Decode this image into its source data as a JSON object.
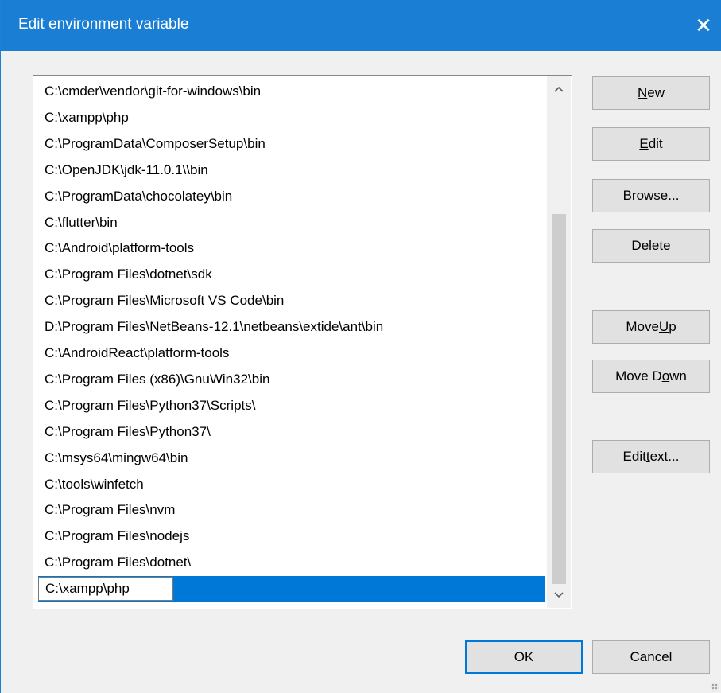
{
  "window": {
    "title": "Edit environment variable",
    "close_glyph": "✕"
  },
  "list": {
    "items": [
      "C:\\cmder\\vendor\\git-for-windows\\bin",
      "C:\\xampp\\php",
      "C:\\ProgramData\\ComposerSetup\\bin",
      "C:\\OpenJDK\\jdk-11.0.1\\\\bin",
      "C:\\ProgramData\\chocolatey\\bin",
      "C:\\flutter\\bin",
      "C:\\Android\\platform-tools",
      "C:\\Program Files\\dotnet\\sdk",
      "C:\\Program Files\\Microsoft VS Code\\bin",
      "D:\\Program Files\\NetBeans-12.1\\netbeans\\extide\\ant\\bin",
      "C:\\AndroidReact\\platform-tools",
      "C:\\Program Files (x86)\\GnuWin32\\bin",
      "C:\\Program Files\\Python37\\Scripts\\",
      "C:\\Program Files\\Python37\\",
      "C:\\msys64\\mingw64\\bin",
      "C:\\tools\\winfetch",
      "C:\\Program Files\\nvm",
      "C:\\Program Files\\nodejs",
      "C:\\Program Files\\dotnet\\"
    ],
    "editing_value": "C:\\xampp\\php",
    "scroll_up_icon": "up-arrow",
    "scroll_down_icon": "down-arrow"
  },
  "buttons": {
    "new": {
      "pre": "",
      "accel": "N",
      "post": "ew"
    },
    "edit": {
      "pre": "",
      "accel": "E",
      "post": "dit"
    },
    "browse": {
      "pre": "",
      "accel": "B",
      "post": "rowse..."
    },
    "delete": {
      "pre": "",
      "accel": "D",
      "post": "elete"
    },
    "move_up": {
      "pre": "Move ",
      "accel": "U",
      "post": "p"
    },
    "move_down": {
      "pre": "Move D",
      "accel": "o",
      "post": "wn"
    },
    "edit_text": {
      "pre": "Edit ",
      "accel": "t",
      "post": "ext..."
    },
    "ok": "OK",
    "cancel": "Cancel"
  },
  "colors": {
    "titlebar": "#1a7fd4",
    "selection": "#0078d7",
    "dialog_bg": "#f0f0f0"
  }
}
